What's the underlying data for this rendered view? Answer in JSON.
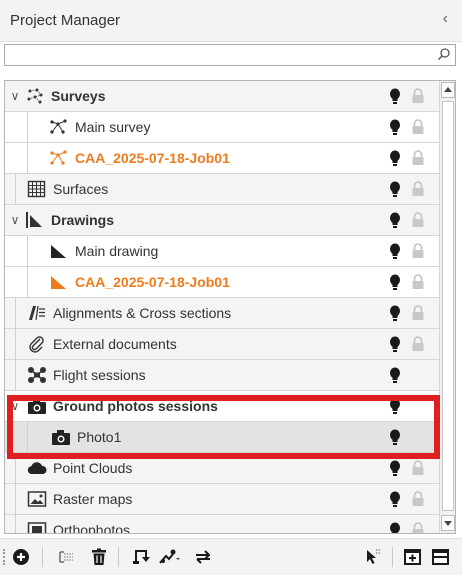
{
  "panel": {
    "title": "Project Manager",
    "collapse_glyph": "‹"
  },
  "search": {
    "value": "",
    "placeholder": "",
    "icon": "search-icon"
  },
  "tree": {
    "rows": [
      {
        "label": "Surveys",
        "icon": "survey-group-icon",
        "expander": "∨",
        "style": "bold",
        "bulb": true,
        "lock": true
      },
      {
        "label": "Main survey",
        "icon": "survey-icon",
        "style": "normal",
        "bulb": true,
        "lock": true
      },
      {
        "label": "CAA_2025-07-18-Job01",
        "icon": "survey-icon-orange",
        "style": "orange",
        "bulb": true,
        "lock": true
      },
      {
        "label": "Surfaces",
        "icon": "grid-icon",
        "style": "normal",
        "bulb": true,
        "lock": true
      },
      {
        "label": "Drawings",
        "icon": "drawing-group-icon",
        "expander": "∨",
        "style": "bold",
        "bulb": true,
        "lock": true
      },
      {
        "label": "Main drawing",
        "icon": "drawing-icon",
        "style": "normal",
        "bulb": true,
        "lock": true
      },
      {
        "label": "CAA_2025-07-18-Job01",
        "icon": "drawing-icon-orange",
        "style": "orange",
        "bulb": true,
        "lock": true
      },
      {
        "label": "Alignments & Cross sections",
        "icon": "alignment-icon",
        "style": "normal",
        "bulb": true,
        "lock": true
      },
      {
        "label": "External documents",
        "icon": "paperclip-icon",
        "style": "normal",
        "bulb": true,
        "lock": true
      },
      {
        "label": "Flight sessions",
        "icon": "drone-icon",
        "style": "normal",
        "bulb": true,
        "lock": false
      },
      {
        "label": "Ground photos sessions",
        "icon": "camera-icon",
        "expander": "∨",
        "style": "bold",
        "bulb": true,
        "lock": false
      },
      {
        "label": "Photo1",
        "icon": "camera-icon",
        "style": "normal",
        "bulb": true,
        "lock": false
      },
      {
        "label": "Point Clouds",
        "icon": "cloud-icon",
        "style": "normal",
        "bulb": true,
        "lock": true
      },
      {
        "label": "Raster maps",
        "icon": "raster-icon",
        "style": "normal",
        "bulb": true,
        "lock": true
      },
      {
        "label": "Orthophotos",
        "icon": "ortho-icon",
        "style": "normal",
        "bulb": true,
        "lock": true
      }
    ]
  },
  "toolbar": {
    "buttons": [
      "add-icon",
      "select-range-icon",
      "delete-icon",
      "rotate-icon",
      "tools-dropdown-icon",
      "sync-icon",
      "select-cursor-icon",
      "new-window-icon",
      "window-icon"
    ]
  },
  "colors": {
    "accent_orange": "#f07b1d",
    "highlight_red": "#e02020",
    "selected_row": "#e3e3e3"
  }
}
